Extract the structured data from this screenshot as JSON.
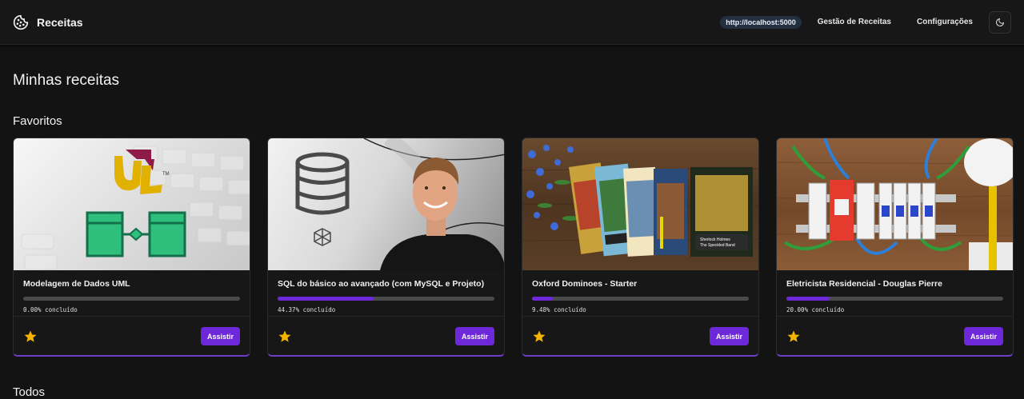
{
  "navbar": {
    "brand": "Receitas",
    "url": "http://localhost:5000",
    "links": [
      "Gestão de Receitas",
      "Configurações"
    ]
  },
  "page_title": "Minhas receitas",
  "sections": {
    "favorites": "Favoritos",
    "all": "Todos"
  },
  "cards": [
    {
      "title": "Modelagem de Dados UML",
      "progress": 0.0,
      "progress_text": "0.00% concluído",
      "button": "Assistir",
      "thumbnail": "uml-diagram-keyboard"
    },
    {
      "title": "SQL do básico ao avançado (com MySQL e Projeto)",
      "progress": 44.37,
      "progress_text": "44.37% concluído",
      "button": "Assistir",
      "thumbnail": "database-instructor"
    },
    {
      "title": "Oxford Dominoes - Starter",
      "progress": 9.48,
      "progress_text": "9.48% concluído",
      "button": "Assistir",
      "thumbnail": "books-on-wood"
    },
    {
      "title": "Eletricista Residencial - Douglas Pierre",
      "progress": 20.0,
      "progress_text": "20.00% concluído",
      "button": "Assistir",
      "thumbnail": "electrical-panel"
    }
  ],
  "icons": {
    "brand": "cookie-icon",
    "theme": "moon-icon",
    "favorite": "star-icon"
  },
  "colors": {
    "accent": "#6d28d9",
    "star": "#f5b301",
    "background": "#131313"
  }
}
